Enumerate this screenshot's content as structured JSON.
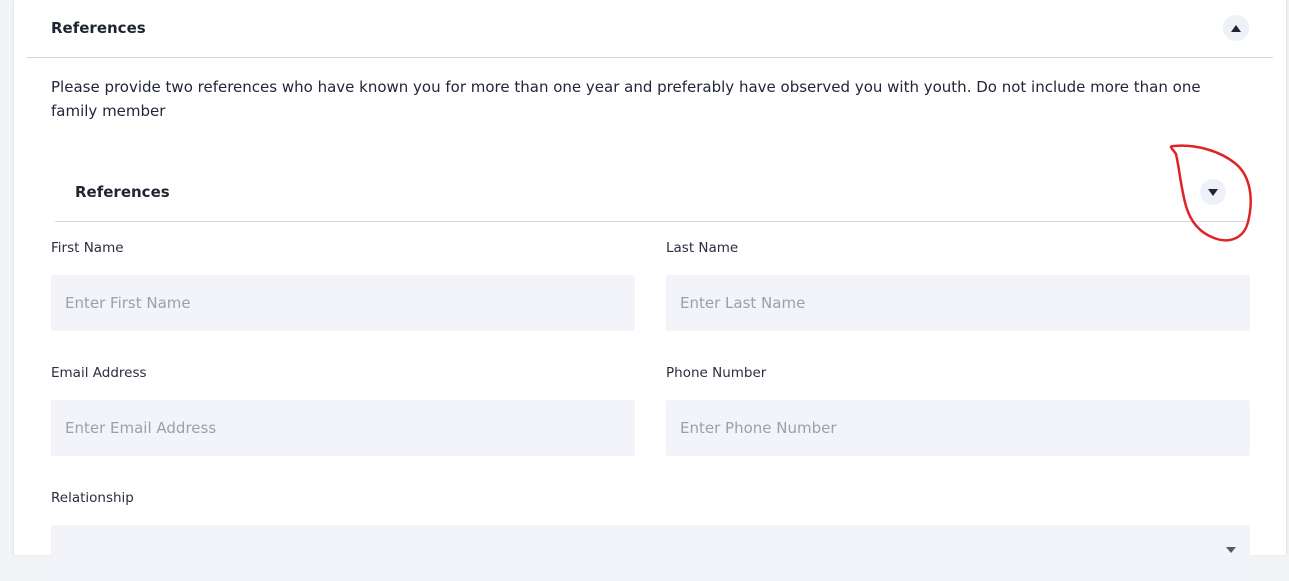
{
  "outer_section": {
    "title": "References",
    "description": "Please provide two references who have known you for more than one year and preferably have observed you with youth. Do not include more than one family member",
    "toggle_icon": "chevron-up-icon"
  },
  "inner_section": {
    "title": "References",
    "toggle_icon": "chevron-down-icon"
  },
  "form": {
    "first_name": {
      "label": "First Name",
      "placeholder": "Enter First Name",
      "value": ""
    },
    "last_name": {
      "label": "Last Name",
      "placeholder": "Enter Last Name",
      "value": ""
    },
    "email": {
      "label": "Email Address",
      "placeholder": "Enter Email Address",
      "value": ""
    },
    "phone": {
      "label": "Phone Number",
      "placeholder": "Enter Phone Number",
      "value": ""
    },
    "relationship": {
      "label": "Relationship",
      "selected": "",
      "caret_icon": "caret-down-icon"
    }
  },
  "annotation": {
    "type": "red-circle-highlight",
    "color": "#e02424"
  },
  "colors": {
    "input_background": "#f2f4f9",
    "text": "#22263a",
    "placeholder": "#9aa0ad"
  }
}
